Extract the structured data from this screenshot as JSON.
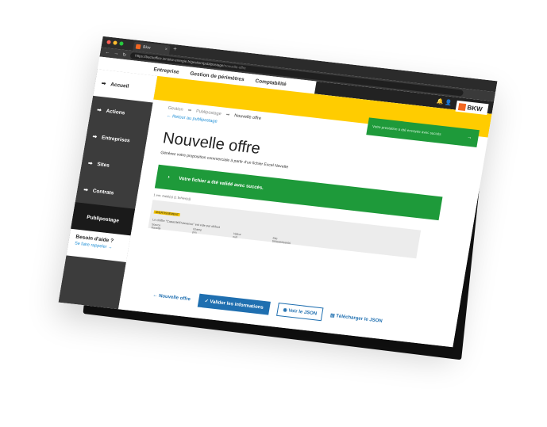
{
  "browser": {
    "tab_title": "Bkw",
    "url_main": "https://backoffice.int.bkw-energie.fr/gestion/publipostage",
    "url_tail": "/nouvelle-offre"
  },
  "topnav": {
    "items": [
      "Entreprise",
      "Gestion de périmètres",
      "Comptabilité"
    ]
  },
  "brand": {
    "name": "BKW",
    "accent": "#f26722"
  },
  "sidebar": {
    "items": [
      {
        "label": "Accueil"
      },
      {
        "label": "Actions"
      },
      {
        "label": "Entreprises"
      },
      {
        "label": "Sites"
      },
      {
        "label": "Contrats"
      },
      {
        "label": "Publipostage"
      }
    ],
    "help_title": "Besoin d'aide ?",
    "help_link": "Se faire rappeler"
  },
  "toast": {
    "text": "Votre prestation a été envoyée avec succès"
  },
  "breadcrumb": [
    "Gestion",
    "Publipostage",
    "Nouvelle offre"
  ],
  "back_link": "Retour au publipostage",
  "page": {
    "title": "Nouvelle offre",
    "subtitle": "Générez votre proposition commerciale à partir d'un fichier Excel Navette"
  },
  "success": {
    "text": "Votre fichier a été validé avec succès."
  },
  "file": {
    "meta": "1 enr. traité(s) (1 fichier(s))",
    "badge": "AVERTISSEMENT",
    "line": "Le chiffre \"Capacité/Puissance\" est vide par défaut",
    "cols": [
      {
        "k": "Source",
        "v": "Navette"
      },
      {
        "k": "Champ",
        "v": "prix"
      },
      {
        "k": "Valeur",
        "v": "null"
      },
      {
        "k": "Site",
        "v": "566666666666"
      }
    ]
  },
  "actions": {
    "new_offer": "Nouvelle offre",
    "validate": "Valider les informations",
    "view_json": "Voir le JSON",
    "download_json": "Télécharger le JSON"
  },
  "colors": {
    "yellow": "#ffcc00",
    "green": "#1e9a3a",
    "blue": "#1f6fb0"
  }
}
